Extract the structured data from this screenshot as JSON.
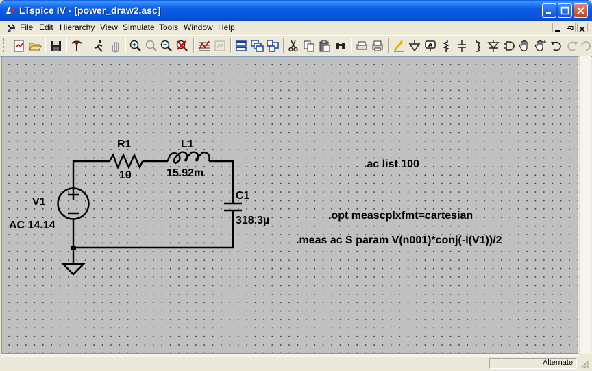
{
  "window": {
    "title": "LTspice IV - [power_draw2.asc]"
  },
  "menu": {
    "items": [
      "File",
      "Edit",
      "Hierarchy",
      "View",
      "Simulate",
      "Tools",
      "Window",
      "Help"
    ]
  },
  "toolbar": {
    "icons": [
      "new-schematic-icon",
      "open-icon",
      "save-icon",
      "control-panel-icon",
      "run-icon",
      "halt-icon",
      "zoom-in-icon",
      "pan-icon",
      "zoom-out-icon",
      "zoom-cancel-icon",
      "autorange-icon",
      "waveform-icon",
      "tile-horizontal-icon",
      "cascade-icon",
      "tile-icon",
      "cut-icon",
      "copy-icon",
      "paste-icon",
      "find-icon",
      "print-setup-icon",
      "print-icon",
      "draw-wire-icon",
      "ground-icon",
      "label-net-icon",
      "resistor-icon",
      "capacitor-icon",
      "inductor-icon",
      "diode-icon",
      "component-icon",
      "move-icon",
      "drag-icon",
      "undo-icon",
      "redo-icon",
      "rotate-icon"
    ]
  },
  "schematic": {
    "r1": {
      "name": "R1",
      "value": "10"
    },
    "l1": {
      "name": "L1",
      "value": "15.92m"
    },
    "c1": {
      "name": "C1",
      "value": "318.3µ"
    },
    "v1": {
      "name": "V1",
      "value": "AC 14.14"
    },
    "directives": {
      "ac": ".ac list 100",
      "opt": ".opt meascplxfmt=cartesian",
      "meas": ".meas ac S param V(n001)*conj(-I(V1))/2"
    }
  },
  "status": {
    "mode": "Alternate"
  },
  "colors": {
    "title_bar": "#0a58e4",
    "canvas_bg": "#c0c0c0",
    "chrome": "#ece9d8"
  }
}
